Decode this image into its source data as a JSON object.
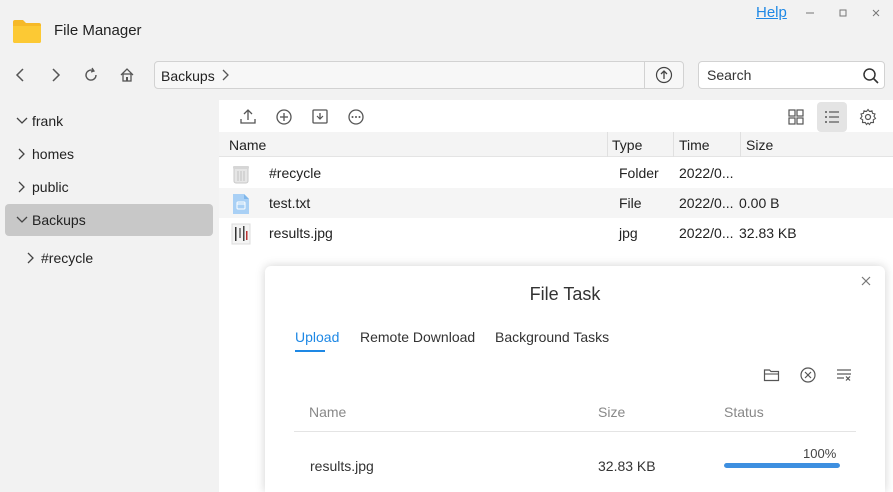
{
  "window": {
    "app_title": "File Manager",
    "help_label": "Help"
  },
  "toolbar": {
    "breadcrumb": "Backups",
    "search_placeholder": "Search"
  },
  "sidebar": {
    "items": [
      {
        "label": "frank",
        "expanded": true
      },
      {
        "label": "homes",
        "expanded": false
      },
      {
        "label": "public",
        "expanded": false
      },
      {
        "label": "Backups",
        "expanded": true,
        "selected": true
      },
      {
        "label": "#recycle",
        "expanded": false
      }
    ]
  },
  "file_list": {
    "columns": {
      "name": "Name",
      "type": "Type",
      "time": "Time",
      "size": "Size"
    },
    "rows": [
      {
        "name": "#recycle",
        "type": "Folder",
        "time": "2022/0...",
        "size": "",
        "icon": "recycle-bin-icon"
      },
      {
        "name": "test.txt",
        "type": "File",
        "time": "2022/0...",
        "size": "0.00 B",
        "icon": "text-file-icon"
      },
      {
        "name": "results.jpg",
        "type": "jpg",
        "time": "2022/0...",
        "size": "32.83 KB",
        "icon": "image-thumbnail-icon"
      }
    ]
  },
  "file_task": {
    "title": "File Task",
    "tabs": [
      "Upload",
      "Remote Download",
      "Background Tasks"
    ],
    "active_tab": "Upload",
    "columns": {
      "name": "Name",
      "size": "Size",
      "status": "Status"
    },
    "tasks": [
      {
        "name": "results.jpg",
        "size": "32.83 KB",
        "progress_label": "100%",
        "progress": 1.0
      }
    ]
  },
  "colors": {
    "accent": "#1e88e5",
    "folder": "#f6b928",
    "progress": "#3d8fe0",
    "selected_bg": "#c8c8c8"
  }
}
